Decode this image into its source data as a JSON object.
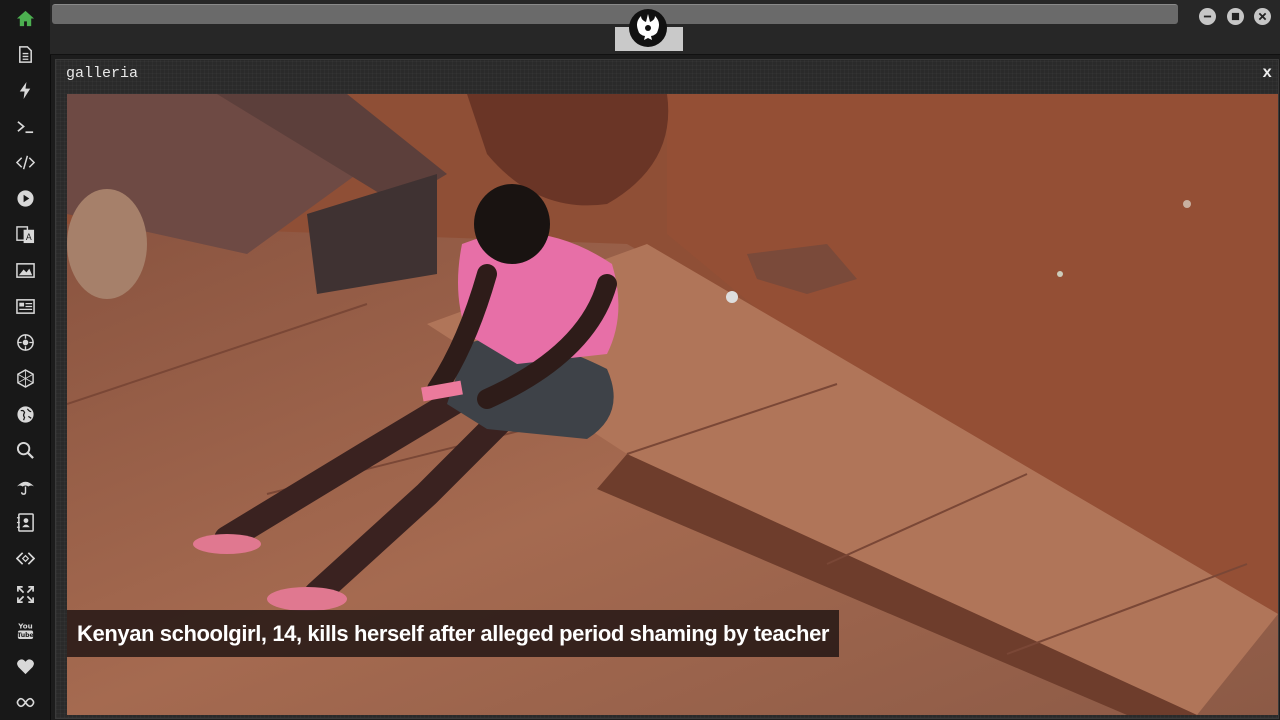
{
  "window": {
    "title": "galleria",
    "close_label": "x"
  },
  "gallery": {
    "caption": "Kenyan schoolgirl, 14, kills herself after alleged period shaming by teacher"
  },
  "dock": {
    "icons": [
      "home-icon",
      "document-icon",
      "lightning-icon",
      "terminal-icon",
      "code-icon",
      "play-icon",
      "translate-icon",
      "image-icon",
      "news-icon",
      "settings-icon",
      "hexagon-icon",
      "globe-icon",
      "search-icon",
      "umbrella-icon",
      "contact-icon",
      "embed-icon",
      "fullscreen-icon",
      "youtube-icon",
      "heart-icon",
      "infinity-icon"
    ],
    "active_color": "#4caf50"
  },
  "topbar": {
    "emblem_icon": "rebel-alliance-icon",
    "controls": [
      "minimize-icon",
      "maximize-icon",
      "close-icon"
    ]
  }
}
